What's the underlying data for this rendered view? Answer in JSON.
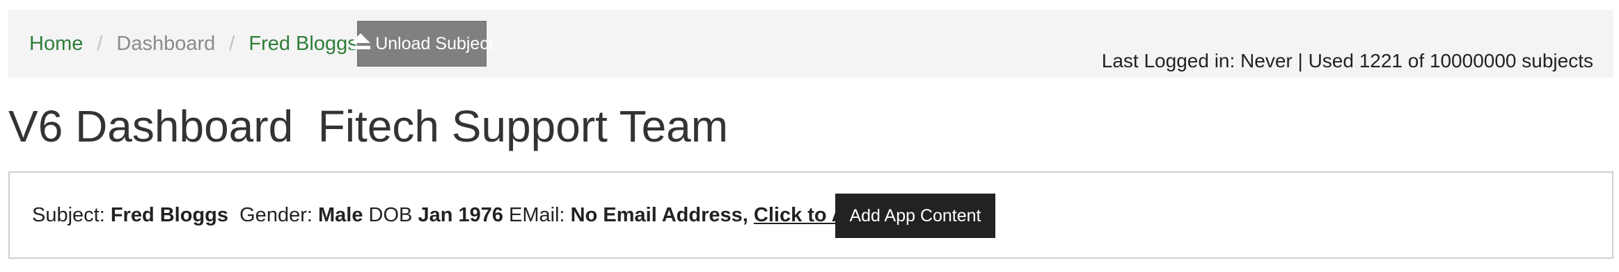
{
  "breadcrumb": {
    "home": "Home",
    "dashboard": "Dashboard",
    "subject": "Fred Bloggs",
    "separator": "/"
  },
  "unload_button": {
    "label": "Unload Subject",
    "icon": "eject-icon"
  },
  "status": {
    "text": "Last Logged in: Never |  Used 1221 of 10000000 subjects"
  },
  "page_title": "V6 Dashboard  Fitech Support Team",
  "subject_panel": {
    "subject_label": "Subject: ",
    "subject_value": "Fred Bloggs",
    "gender_label": "  Gender: ",
    "gender_value": "Male",
    "dob_label": " DOB ",
    "dob_value": "Jan 1976",
    "email_label": " EMail: ",
    "email_value": "No Email Address, ",
    "add_link": "Click to Add"
  },
  "add_app_button": {
    "label": "Add App Content"
  },
  "colors": {
    "link_green": "#2e7d3a",
    "topbar_bg": "#f4f4f4",
    "unload_bg": "#808080",
    "dark_button_bg": "#222222"
  }
}
